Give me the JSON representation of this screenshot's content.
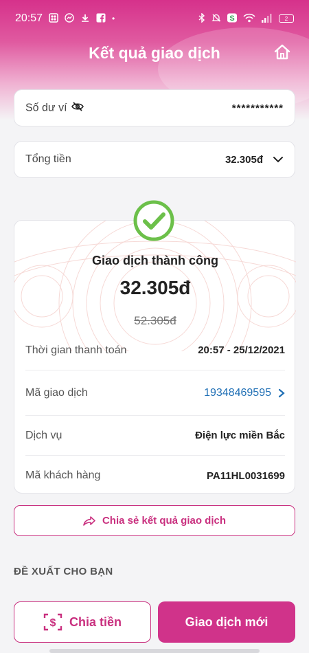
{
  "status_bar": {
    "time": "20:57",
    "left_icons": [
      "momo-icon",
      "messenger-icon",
      "download-icon",
      "facebook-icon",
      "dot-icon"
    ],
    "right_icons": [
      "bluetooth-icon",
      "alarm-icon",
      "vpn-icon",
      "wifi-icon",
      "signal-icon"
    ],
    "battery": "2"
  },
  "header": {
    "title": "Kết quả giao dịch",
    "home_icon": "home-icon"
  },
  "wallet": {
    "label": "Số dư ví",
    "value": "***********",
    "eye_icon": "eye-off-icon"
  },
  "total": {
    "label": "Tổng tiền",
    "value": "32.305đ",
    "chevron_icon": "chevron-down-icon"
  },
  "result": {
    "title": "Giao dịch thành công",
    "amount": "32.305đ",
    "original_amount": "52.305đ",
    "success_icon": "check-circle-icon",
    "rows": [
      {
        "label": "Thời gian thanh toán",
        "value": "20:57 - 25/12/2021"
      },
      {
        "label": "Mã giao dịch",
        "value": "19348469595"
      },
      {
        "label": "Dịch vụ",
        "value": "Điện lực miền Bắc"
      },
      {
        "label": "Mã khách hàng",
        "value": "PA11HL0031699"
      }
    ]
  },
  "share": {
    "label": "Chia sẻ kết quả giao dịch",
    "icon": "share-icon"
  },
  "suggest": {
    "title": "ĐỀ XUẤT CHO BẠN"
  },
  "actions": {
    "split_label": "Chia tiền",
    "split_icon": "split-money-icon",
    "new_label": "Giao dịch mới"
  },
  "colors": {
    "brand": "#d0338a",
    "link": "#1f6fb5",
    "success": "#6cc04a"
  }
}
